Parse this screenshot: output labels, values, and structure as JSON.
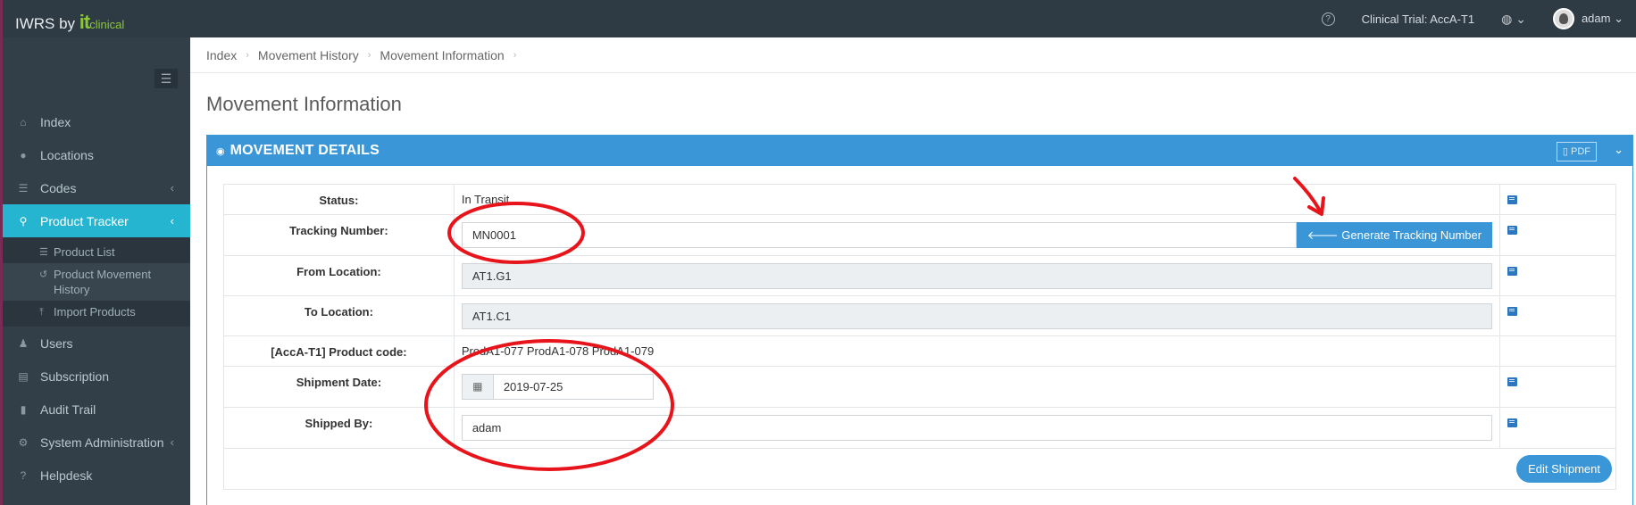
{
  "topbar": {
    "brand_prefix": "IWRS by ",
    "brand_it": "it",
    "brand_clinical": "clinical",
    "help_icon": "?",
    "trial_label": "Clinical Trial: AccA-T1",
    "globe_icon": "globe-icon",
    "globe_chevron": "⌄",
    "username": "adam",
    "user_chevron": "⌄"
  },
  "sidebar": {
    "toggle_icon": "☰",
    "items": [
      {
        "label": "Index",
        "icon": "⌂"
      },
      {
        "label": "Locations",
        "icon": "●"
      },
      {
        "label": "Codes",
        "icon": "☰",
        "chevron": "‹"
      },
      {
        "label": "Product Tracker",
        "icon": "⚲",
        "chevron": "‹",
        "active": true
      },
      {
        "label": "Users",
        "icon": "👥"
      },
      {
        "label": "Subscription",
        "icon": "▤"
      },
      {
        "label": "Audit Trail",
        "icon": "▮"
      },
      {
        "label": "System Administration",
        "icon": "⚙",
        "chevron": "‹"
      },
      {
        "label": "Helpdesk",
        "icon": "?"
      }
    ],
    "subitems": [
      {
        "label": "Product List",
        "icon": "☰"
      },
      {
        "label": "Product Movement History",
        "icon": "↺"
      },
      {
        "label": "Import Products",
        "icon": "⤒"
      }
    ]
  },
  "breadcrumb": {
    "items": [
      "Index",
      "Movement History",
      "Movement Information"
    ],
    "separator": "›"
  },
  "page": {
    "title": "Movement Information"
  },
  "panel": {
    "title": "MOVEMENT DETAILS",
    "pdf_label": "PDF",
    "collapse_icon": "⌄"
  },
  "fields": {
    "status_label": "Status:",
    "status_value": "In Transit",
    "tracking_label": "Tracking Number:",
    "tracking_value": "MN0001",
    "generate_label": "Generate Tracking Number",
    "from_label": "From Location:",
    "from_value": "AT1.G1",
    "to_label": "To Location:",
    "to_value": "AT1.C1",
    "product_code_label": "[AccA-T1] Product code:",
    "product_code_value": "ProdA1-077 ProdA1-078 ProdA1-079",
    "shipment_date_label": "Shipment Date:",
    "shipment_date_value": "2019-07-25",
    "shipped_by_label": "Shipped By:",
    "shipped_by_value": "adam",
    "edit_button": "Edit Shipment"
  },
  "colors": {
    "topbar": "#2f3b44",
    "sidebar": "#333f48",
    "active": "#26b5d1",
    "panel": "#3a96d7",
    "annotation": "#e8141b"
  }
}
